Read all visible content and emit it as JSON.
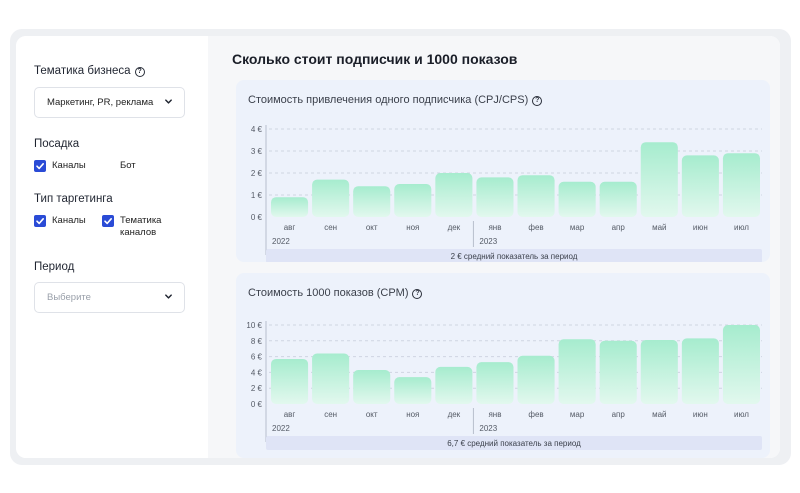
{
  "sidebar": {
    "business_label": "Тематика бизнеса",
    "business_value": "Маркетинг, PR, реклама",
    "placement_label": "Посадка",
    "placement_options": [
      {
        "label": "Каналы",
        "checked": true
      },
      {
        "label": "Бот",
        "checked": false
      }
    ],
    "targeting_label": "Тип таргетинга",
    "targeting_options": [
      {
        "label": "Каналы",
        "checked": true
      },
      {
        "label": "Тематика каналов",
        "checked": true
      }
    ],
    "period_label": "Период",
    "period_placeholder": "Выберите"
  },
  "main": {
    "title": "Сколько стоит подписчик и 1000 показов"
  },
  "colors": {
    "accent": "#2a4bd6",
    "bar_top": "#a6ecce",
    "bar_bottom": "#e2f8ee",
    "card_bg": "#edf2fb",
    "footer_bg": "#dfe4f6"
  },
  "chart_data": [
    {
      "type": "bar",
      "title": "Стоимость привлечения одного подписчика (CPJ/CPS)",
      "categories": [
        "авг",
        "сен",
        "окт",
        "ноя",
        "дек",
        "янв",
        "фев",
        "мар",
        "апр",
        "май",
        "июн",
        "июл"
      ],
      "years": [
        {
          "label": "2022",
          "start_index": 0
        },
        {
          "label": "2023",
          "start_index": 5
        }
      ],
      "values": [
        0.9,
        1.7,
        1.4,
        1.5,
        2.0,
        1.8,
        1.9,
        1.6,
        1.6,
        3.4,
        2.8,
        2.9
      ],
      "yticks": [
        "0 €",
        "1 €",
        "2 €",
        "3 €",
        "4 €"
      ],
      "ylim": [
        0,
        4
      ],
      "footer": "2 € средний показатель за период"
    },
    {
      "type": "bar",
      "title": "Стоимость 1000 показов (CPM)",
      "categories": [
        "авг",
        "сен",
        "окт",
        "ноя",
        "дек",
        "янв",
        "фев",
        "мар",
        "апр",
        "май",
        "июн",
        "июл"
      ],
      "years": [
        {
          "label": "2022",
          "start_index": 0
        },
        {
          "label": "2023",
          "start_index": 5
        }
      ],
      "values": [
        5.7,
        6.4,
        4.3,
        3.4,
        4.7,
        5.3,
        6.1,
        8.2,
        8.0,
        8.1,
        8.3,
        10.0
      ],
      "yticks": [
        "0 €",
        "2 €",
        "4 €",
        "6 €",
        "8 €",
        "10 €"
      ],
      "ylim": [
        0,
        10
      ],
      "footer": "6,7 € средний показатель за период"
    }
  ]
}
